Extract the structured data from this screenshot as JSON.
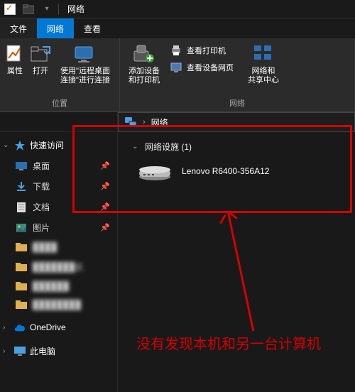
{
  "title": "网络",
  "tabs": {
    "file": "文件",
    "network": "网络",
    "view": "查看"
  },
  "ribbon": {
    "group_location": "位置",
    "group_network": "网络",
    "props": "属性",
    "open": "打开",
    "rdc": "使用\"远程桌面\n连接\"进行连接",
    "add_dev": "添加设备\n和打印机",
    "view_printers": "查看打印机",
    "view_dev_page": "查看设备网页",
    "net_center": "网络和\n共享中心"
  },
  "address": {
    "crumb": "网络"
  },
  "content": {
    "group_label": "网络设施 (1)",
    "device_name": "Lenovo R6400-356A12"
  },
  "sidebar": {
    "quick": "快速访问",
    "desktop": "桌面",
    "downloads": "下载",
    "documents": "文档",
    "pictures": "图片",
    "f1": "████",
    "f2": "███████此",
    "f3": "██████",
    "f4": "████████",
    "onedrive": "OneDrive",
    "thispc": "此电脑"
  },
  "annotation": "没有发现本机和另一台计算机"
}
